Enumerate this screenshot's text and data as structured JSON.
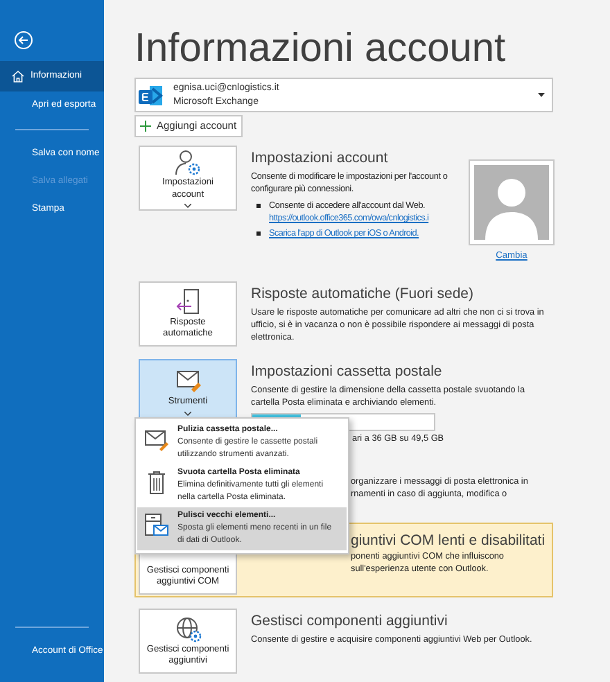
{
  "sidebar": {
    "groups": [
      [
        {
          "label": "Informazioni",
          "selected": true,
          "disabled": false
        },
        {
          "label": "Apri ed esporta",
          "selected": false,
          "disabled": false
        }
      ],
      [
        {
          "label": "Salva con nome",
          "selected": false,
          "disabled": false
        },
        {
          "label": "Salva allegati",
          "selected": false,
          "disabled": true
        },
        {
          "label": "Stampa",
          "selected": false,
          "disabled": false
        }
      ],
      [
        {
          "label": "Account di Office",
          "selected": false,
          "disabled": false
        }
      ]
    ]
  },
  "page_title": "Informazioni account",
  "account": {
    "email": "egnisa.uci@cnlogistics.it",
    "type": "Microsoft Exchange"
  },
  "add_account_button": "Aggiungi account",
  "sections": [
    {
      "kind": "account",
      "tile": "Impostazioni account",
      "dropdown": true,
      "selected": false,
      "heading": "Impostazioni account",
      "description": "Consente di modificare le impostazioni per l'account o configurare più connessioni.",
      "bullets": [
        {
          "text": "Consente di accedere all'account dal Web.",
          "link": "https://outlook.office365.com/owa/cnlogistics.i"
        },
        {
          "link": "Scarica l'app di Outlook per iOS o Android."
        }
      ],
      "photo_link": "Cambia"
    },
    {
      "kind": "plain",
      "tile": "Risposte automatiche",
      "dropdown": false,
      "selected": false,
      "heading": "Risposte automatiche (Fuori sede)",
      "description": "Usare le risposte automatiche per comunicare ad altri che non ci si trova in ufficio, si è in vacanza o non è possibile rispondere ai messaggi di posta elettronica."
    },
    {
      "kind": "mailbox",
      "tile": "Strumenti",
      "dropdown": true,
      "selected": true,
      "heading": "Impostazioni cassetta postale",
      "description": "Consente di gestire la dimensione della cassetta postale svuotando la cartella Posta eliminata e archiviando elementi.",
      "level": 0.27,
      "reading": "ari a 36 GB su 49,5 GB"
    },
    {
      "kind": "covered",
      "description_lines": [
        "organizzare i messaggi di posta elettronica in",
        "rnamenti in caso di aggiunta, modifica o"
      ]
    },
    {
      "kind": "warning",
      "tile": "Gestisci componenti aggiuntivi COM",
      "heading": "giuntivi COM lenti e disabilitati",
      "description_lines": [
        "ponenti aggiuntivi COM che influiscono",
        "sull'esperienza utente con Outlook."
      ]
    },
    {
      "kind": "plain",
      "tile": "Gestisci componenti aggiuntivi",
      "dropdown": false,
      "selected": false,
      "heading": "Gestisci componenti aggiuntivi",
      "description": "Consente di gestire e acquisire componenti aggiuntivi Web per Outlook."
    }
  ],
  "tools_menu": {
    "items": [
      {
        "title": "Pulizia cassetta postale...",
        "description": "Consente di gestire le cassette postali utilizzando strumenti avanzati.",
        "selected": false
      },
      {
        "title": "Svuota cartella Posta eliminata",
        "description": "Elimina definitivamente tutti gli elementi nella cartella Posta eliminata.",
        "selected": false
      },
      {
        "title": "Pulisci vecchi elementi...",
        "description": "Sposta gli elementi meno recenti in un file di dati di Outlook.",
        "selected": true
      }
    ]
  }
}
